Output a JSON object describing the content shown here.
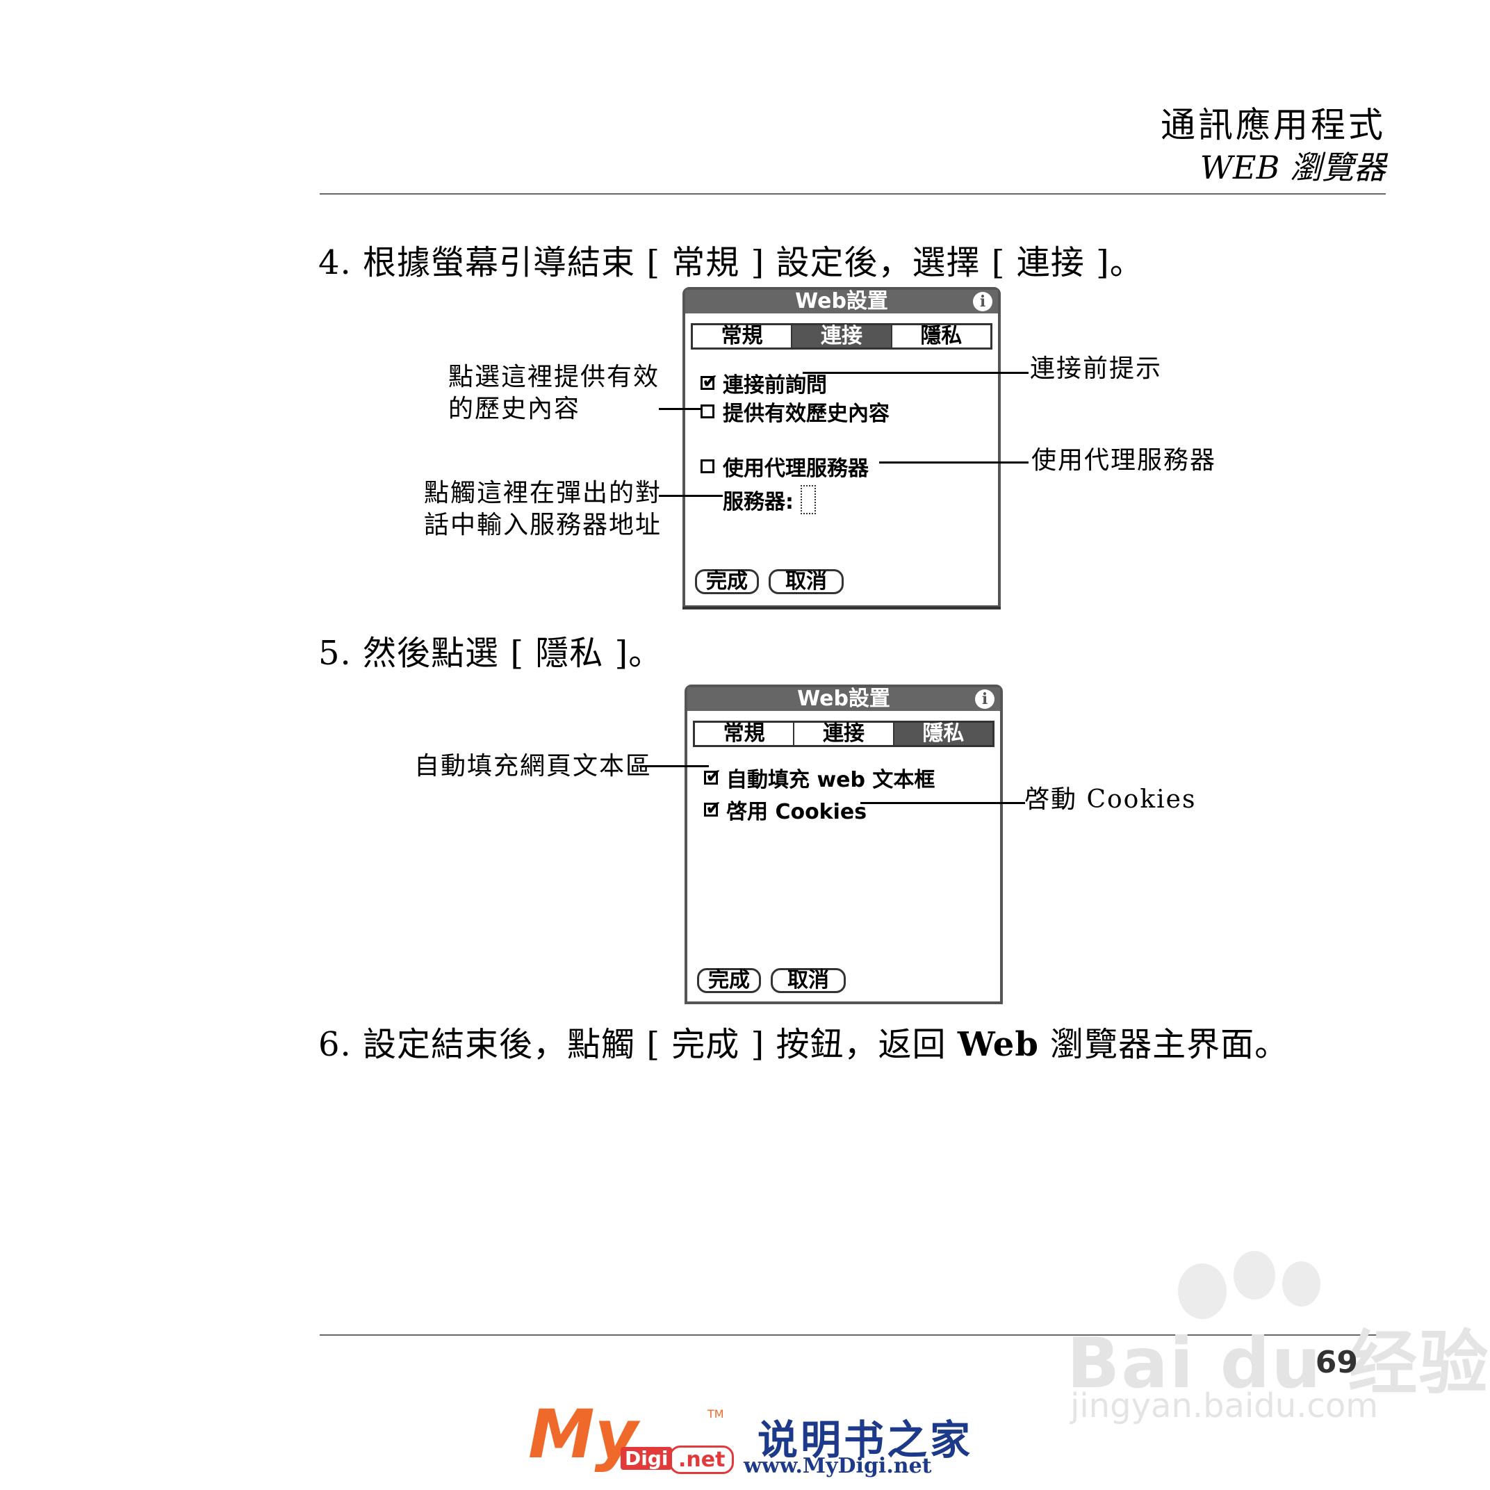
{
  "header": {
    "title": "通訊應用程式",
    "subtitle": "WEB 瀏覽器"
  },
  "steps": {
    "step4": "4. 根據螢幕引導結束 [ 常規 ] 設定後，選擇 [ 連接 ]。",
    "step5": "5. 然後點選 [ 隱私 ]。",
    "step6_pre": "6. 設定結束後，點觸 [ 完成 ] 按鈕，返回 ",
    "step6_bold": "Web",
    "step6_post": " 瀏覽器主界面。"
  },
  "screen1": {
    "title": "Web設置",
    "info_icon": "i",
    "tabs": [
      "常規",
      "連接",
      "隱私"
    ],
    "selected_tab": "連接",
    "options": [
      {
        "label": "連接前詢問",
        "checked": true
      },
      {
        "label": "提供有效歷史內容",
        "checked": false
      },
      {
        "label": "使用代理服務器",
        "checked": false
      }
    ],
    "server_label": "服務器:",
    "buttons": {
      "done": "完成",
      "cancel": "取消"
    },
    "callouts": {
      "history_line1": "點選這裡提供有效",
      "history_line2": "的歷史內容",
      "server_line1": "點觸這裡在彈出的對",
      "server_line2": "話中輸入服務器地址",
      "ask": "連接前提示",
      "proxy": "使用代理服務器"
    }
  },
  "screen2": {
    "title": "Web設置",
    "info_icon": "i",
    "tabs": [
      "常規",
      "連接",
      "隱私"
    ],
    "selected_tab": "隱私",
    "options": [
      {
        "label": "自動填充 web 文本框",
        "checked": true
      },
      {
        "label": "啓用 Cookies",
        "checked": true
      }
    ],
    "buttons": {
      "done": "完成",
      "cancel": "取消"
    },
    "callouts": {
      "autofill": "自動填充網頁文本區",
      "cookies": "啓動 Cookies"
    }
  },
  "footer": {
    "page_number": "69",
    "watermark_brand": "Bai du 经验",
    "watermark_url": "jingyan.baidu.com",
    "logo_my": "My",
    "logo_tm": "TM",
    "logo_digi": "Digi",
    "logo_net": ".net",
    "logo_cn": "说明书之家",
    "logo_url": "www.MyDigi.net"
  }
}
